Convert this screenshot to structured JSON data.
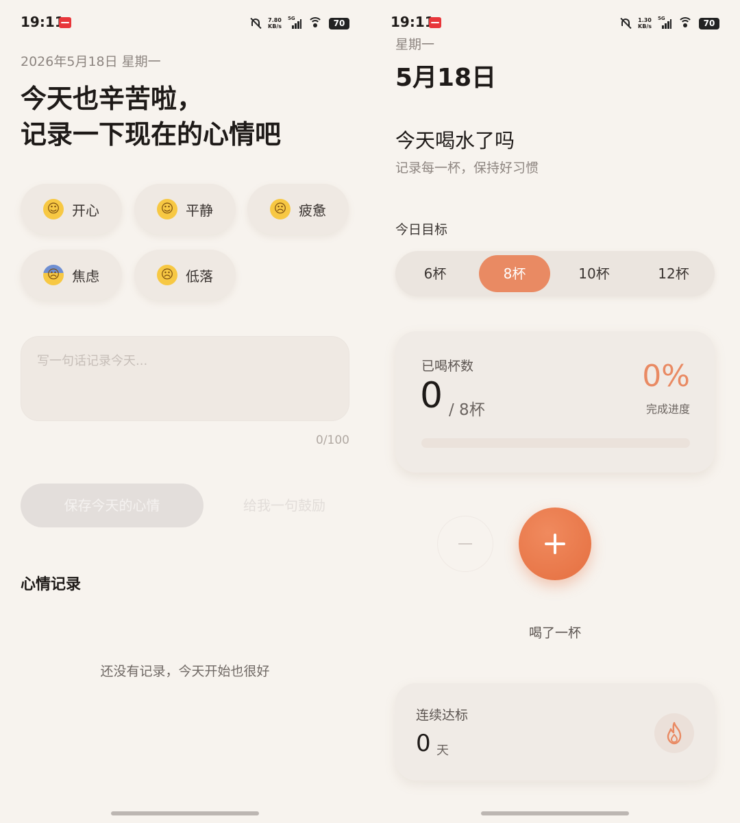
{
  "status_left": {
    "time": "19:11",
    "net_speed_value": "7.80",
    "net_speed_unit": "KB/s",
    "network": "5G",
    "battery": "70"
  },
  "status_right": {
    "time": "19:11",
    "net_speed_value": "1.30",
    "net_speed_unit": "KB/s",
    "network": "5G",
    "battery": "70"
  },
  "mood": {
    "date": "2026年5月18日 星期一",
    "headline_line1": "今天也辛苦啦，",
    "headline_line2": "记录一下现在的心情吧",
    "options": [
      {
        "icon": "smiling-face-icon",
        "glyph": "☺",
        "label": "开心"
      },
      {
        "icon": "relieved-face-icon",
        "glyph": "☺",
        "label": "平静"
      },
      {
        "icon": "pensive-face-icon",
        "glyph": "☹",
        "label": "疲惫"
      },
      {
        "icon": "anxious-face-icon",
        "glyph": "☹",
        "label": "焦虑"
      },
      {
        "icon": "crying-face-icon",
        "glyph": "☹",
        "label": "低落"
      }
    ],
    "note_placeholder": "写一句话记录今天...",
    "char_count": "0/100",
    "save_button": "保存今天的心情",
    "cheer_button": "给我一句鼓励",
    "records_title": "心情记录",
    "empty_text": "还没有记录，今天开始也很好"
  },
  "water": {
    "weekday": "星期一",
    "date": "5月18日",
    "title": "今天喝水了吗",
    "subtitle": "记录每一杯，保持好习惯",
    "goal_label": "今日目标",
    "goal_options": [
      "6杯",
      "8杯",
      "10杯",
      "12杯"
    ],
    "selected_goal": "8杯",
    "drunk_label": "已喝杯数",
    "drunk_count": "0",
    "goal_text": "/ 8杯",
    "percent": "0%",
    "percent_label": "完成进度",
    "progress_fraction": 0,
    "add_label": "喝了一杯",
    "streak_label": "连续达标",
    "streak_value": "0",
    "streak_unit": "天",
    "accent_color": "#e98a63"
  }
}
